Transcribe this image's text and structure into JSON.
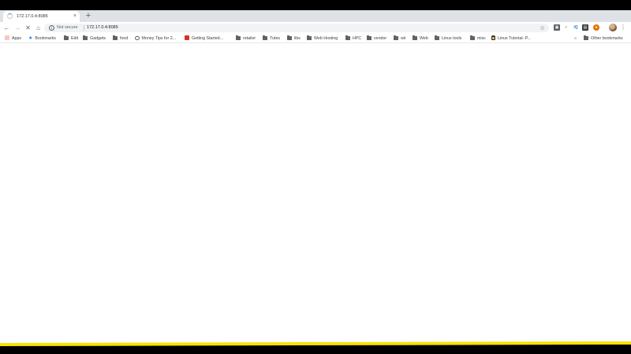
{
  "tab": {
    "title": "172.17.0.4:8085",
    "close_glyph": "×"
  },
  "new_tab_glyph": "+",
  "toolbar": {
    "back_glyph": "←",
    "forward_glyph": "→",
    "stop_glyph": "✕",
    "home_glyph": "⌂",
    "security_label": "Not secure",
    "url": "172.17.0.4:8085",
    "star_glyph": "☆",
    "menu_glyph": "⋮"
  },
  "extensions": [
    {
      "name": "ext-1",
      "color": "#5f6368",
      "glyph": "▣"
    },
    {
      "name": "ext-2",
      "color": "#5f6368",
      "glyph": "✓"
    },
    {
      "name": "ext-3",
      "color": "#1a73e8",
      "glyph": "iQ"
    },
    {
      "name": "ext-4",
      "color": "#3c4043",
      "glyph": "▤"
    },
    {
      "name": "ext-5",
      "color": "#e37400",
      "glyph": "●"
    }
  ],
  "bookmarks": {
    "apps": "Apps",
    "bookmarks": "Bookmarks",
    "items": [
      "Edit",
      "Gadgets",
      "food"
    ],
    "money": "Money Tips for 2...",
    "getting_started": "Getting Started...",
    "folders": [
      "retailer",
      "Tutes",
      "libs",
      "Web Hosting",
      "HPC",
      "vendor",
      "wii",
      "Web",
      "Linux tools",
      "misc"
    ],
    "linux_tutorial": "Linux Tutorial- P...",
    "overflow": "»",
    "other": "Other bookmarks"
  },
  "colors": {
    "accent": "#1a73e8",
    "tabstrip": "#dee1e6",
    "recording_bar": "#f8e200"
  }
}
